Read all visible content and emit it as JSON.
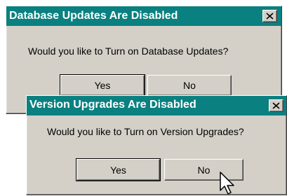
{
  "dialogs": [
    {
      "title": "Database Updates Are Disabled",
      "message": "Would you like to Turn on Database Updates?",
      "yes_label": "Yes",
      "no_label": "No"
    },
    {
      "title": "Version Upgrades Are Disabled",
      "message": "Would you like to Turn on Version Upgrades?",
      "yes_label": "Yes",
      "no_label": "No"
    }
  ],
  "icons": {
    "close": "close-x-icon",
    "cursor": "arrow-cursor-icon"
  },
  "colors": {
    "titlebar": "#0a8080",
    "face": "#d4d0c8",
    "title_text": "#ffffff"
  }
}
